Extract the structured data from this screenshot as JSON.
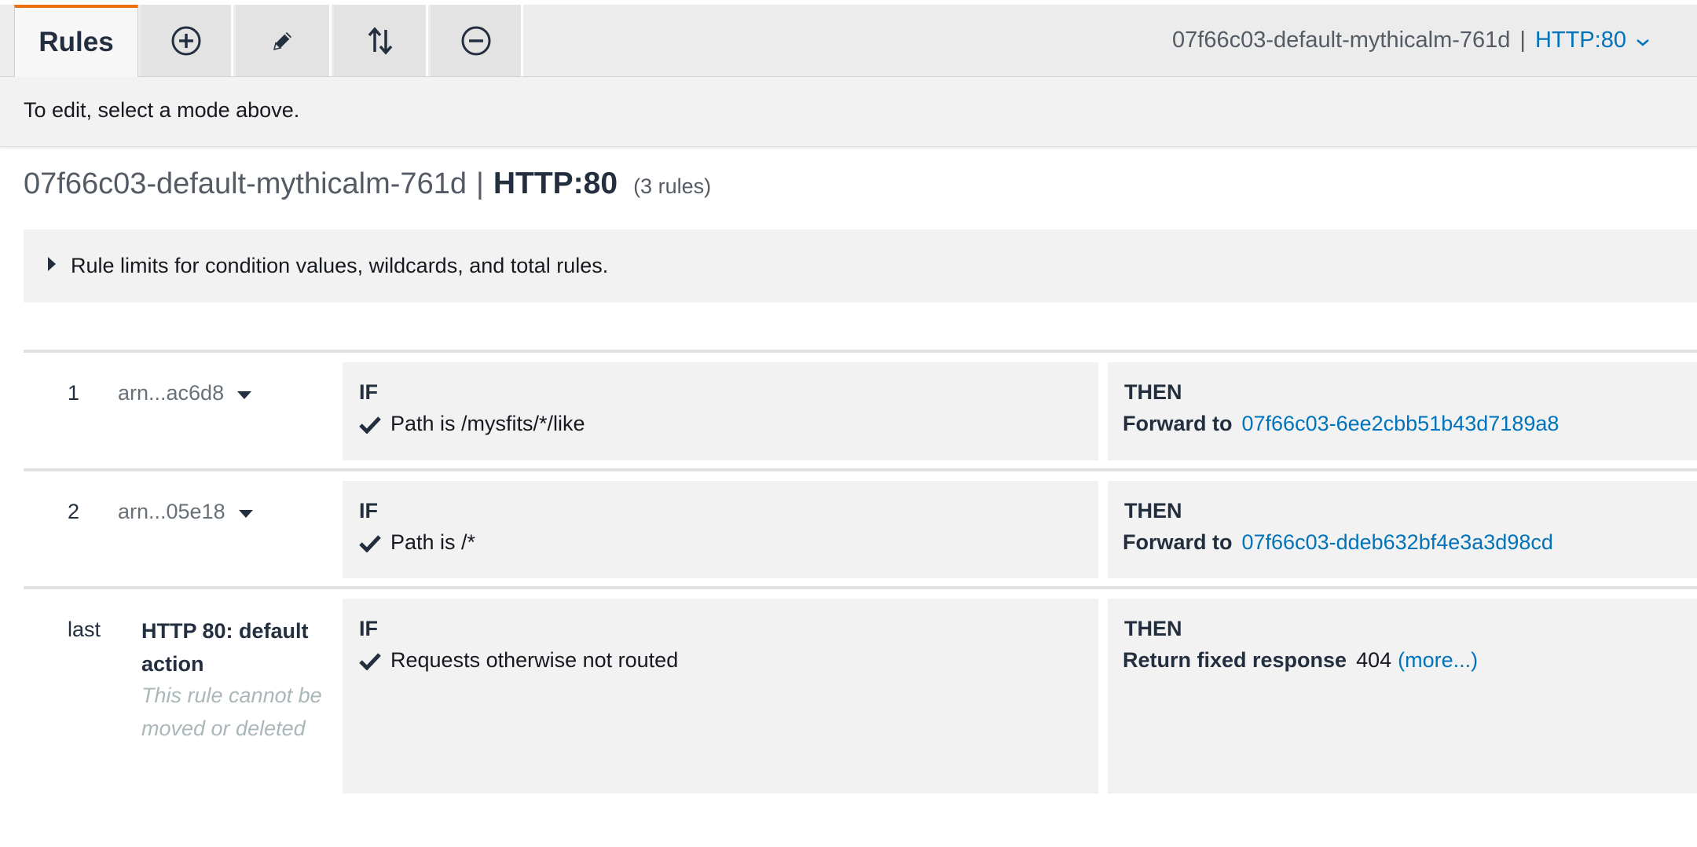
{
  "toolbar": {
    "tabs": [
      {
        "label": "Rules",
        "active": true
      },
      {
        "icon": "add-circle-icon"
      },
      {
        "icon": "pencil-icon"
      },
      {
        "icon": "reorder-icon"
      },
      {
        "icon": "remove-circle-icon"
      }
    ],
    "load_balancer": "07f66c03-default-mythicalm-761d",
    "separator": "|",
    "listener": "HTTP:80",
    "accent_color": "#ec7211",
    "link_color": "#0073bb"
  },
  "info": {
    "message": "To edit, select a mode above."
  },
  "heading": {
    "load_balancer": "07f66c03-default-mythicalm-761d",
    "separator": "|",
    "listener": "HTTP:80",
    "rule_count": "(3 rules)"
  },
  "limits": {
    "label": "Rule limits for condition values, wildcards, and total rules.",
    "expanded": false
  },
  "rules": [
    {
      "number": "1",
      "arn": "arn...ac6d8",
      "if_label": "IF",
      "condition": "Path is /mysfits/*/like",
      "then_label": "THEN",
      "action": "Forward to",
      "target": "07f66c03-6ee2cbb51b43d7189a8"
    },
    {
      "number": "2",
      "arn": "arn...05e18",
      "if_label": "IF",
      "condition": "Path is /*",
      "then_label": "THEN",
      "action": "Forward to",
      "target": "07f66c03-ddeb632bf4e3a3d98cd"
    },
    {
      "number": "last",
      "title": "HTTP 80: default action",
      "note": "This rule cannot be moved or deleted",
      "if_label": "IF",
      "condition": "Requests otherwise not routed",
      "then_label": "THEN",
      "action": "Return fixed response",
      "code": "404",
      "more": "(more...)"
    }
  ]
}
